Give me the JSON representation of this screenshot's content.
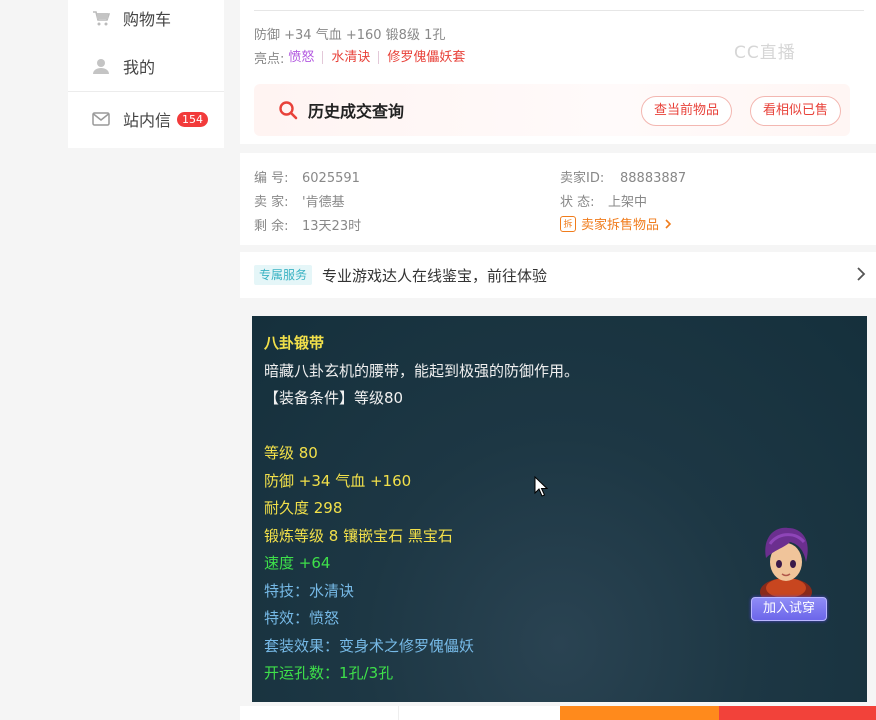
{
  "sidebar": {
    "items": [
      {
        "label": "购物车",
        "icon": "cart-icon"
      },
      {
        "label": "我的",
        "icon": "user-icon"
      },
      {
        "label": "站内信",
        "icon": "mail-icon",
        "badge": "154"
      }
    ]
  },
  "item_summary": {
    "stats": "防御 +34 气血 +160 锻8级 1孔",
    "highlights_label": "亮点:",
    "highlights": [
      "愤怒",
      "水清诀",
      "修罗傀儡妖套"
    ]
  },
  "history": {
    "title": "历史成交查询",
    "btn_current": "查当前物品",
    "btn_similar": "看相似已售"
  },
  "listing_info": {
    "id_label": "编 号:",
    "id_value": "6025591",
    "seller_label": "卖 家:",
    "seller_value": "'肯德基",
    "remaining_label": "剩 余:",
    "remaining_value": "13天23时",
    "seller_id_label": "卖家ID:",
    "seller_id_value": "88883887",
    "status_label": "状 态:",
    "status_value": "上架中",
    "seller_items_link": "卖家拆售物品",
    "seller_items_tag": "拆"
  },
  "service": {
    "tag": "专属服务",
    "text": "专业游戏达人在线鉴宝，前往体验"
  },
  "tooltip": {
    "name": "八卦锻带",
    "desc": "暗藏八卦玄机的腰带，能起到极强的防御作用。",
    "requirement": "【装备条件】等级80",
    "level": "等级 80",
    "defense": "防御 +34 气血 +160",
    "durability": "耐久度 298",
    "forge": "锻炼等级 8 镶嵌宝石 黑宝石",
    "speed": "速度 +64",
    "skill": "特技：水清诀",
    "effect": "特效：愤怒",
    "set": "套装效果：变身术之修罗傀儡妖",
    "holes": "开运孔数：1孔/3孔",
    "try_on": "加入试穿"
  },
  "watermark": "CC直播",
  "colors": {
    "accent_red": "#e8423a",
    "highlight_purple": "#b35ae0",
    "seller_orange": "#f07c1c",
    "service_teal": "#3bb3c3",
    "tooltip_yellow": "#f2e04a",
    "tooltip_green": "#3ee04a",
    "tooltip_blue": "#76b9e6",
    "panel_bg": "#1d3744"
  }
}
